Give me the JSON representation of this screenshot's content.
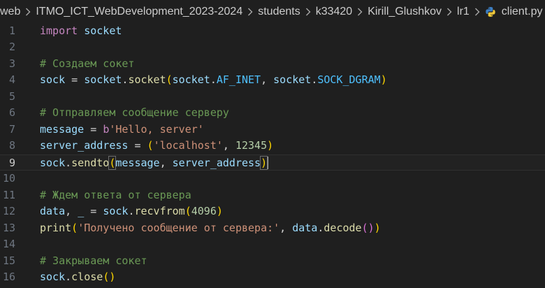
{
  "breadcrumb": {
    "items": [
      "web",
      "ITMO_ICT_WebDevelopment_2023-2024",
      "students",
      "k33420",
      "Kirill_Glushkov",
      "lr1"
    ],
    "file": "client.py",
    "more": "..."
  },
  "editor": {
    "language": "python",
    "current_line": 9,
    "lines": [
      {
        "n": "1",
        "tokens": [
          [
            "kw",
            "import"
          ],
          [
            "op",
            " "
          ],
          [
            "id",
            "socket"
          ]
        ]
      },
      {
        "n": "2",
        "tokens": []
      },
      {
        "n": "3",
        "tokens": [
          [
            "comment",
            "# Создаем сокет"
          ]
        ]
      },
      {
        "n": "4",
        "tokens": [
          [
            "id",
            "sock"
          ],
          [
            "op",
            " = "
          ],
          [
            "id",
            "socket"
          ],
          [
            "op",
            "."
          ],
          [
            "fn",
            "socket"
          ],
          [
            "p1",
            "("
          ],
          [
            "id",
            "socket"
          ],
          [
            "op",
            "."
          ],
          [
            "const",
            "AF_INET"
          ],
          [
            "op",
            ", "
          ],
          [
            "id",
            "socket"
          ],
          [
            "op",
            "."
          ],
          [
            "const",
            "SOCK_DGRAM"
          ],
          [
            "p1",
            ")"
          ]
        ]
      },
      {
        "n": "5",
        "tokens": []
      },
      {
        "n": "6",
        "tokens": [
          [
            "comment",
            "# Отправляем сообщение серверу"
          ]
        ]
      },
      {
        "n": "7",
        "tokens": [
          [
            "id",
            "message"
          ],
          [
            "op",
            " = "
          ],
          [
            "kw",
            "b"
          ],
          [
            "str",
            "'Hello, server'"
          ]
        ]
      },
      {
        "n": "8",
        "tokens": [
          [
            "id",
            "server_address"
          ],
          [
            "op",
            " = "
          ],
          [
            "p1",
            "("
          ],
          [
            "str",
            "'localhost'"
          ],
          [
            "op",
            ", "
          ],
          [
            "num",
            "12345"
          ],
          [
            "p1",
            ")"
          ]
        ]
      },
      {
        "n": "9",
        "tokens": [
          [
            "id",
            "sock"
          ],
          [
            "op",
            "."
          ],
          [
            "fn",
            "sendto"
          ],
          [
            "p1bm",
            "("
          ],
          [
            "id",
            "message"
          ],
          [
            "op",
            ", "
          ],
          [
            "id",
            "server_address"
          ],
          [
            "p1bm",
            ")"
          ],
          [
            "cursor",
            ""
          ]
        ]
      },
      {
        "n": "10",
        "tokens": []
      },
      {
        "n": "11",
        "tokens": [
          [
            "comment",
            "# Ждем ответа от сервера"
          ]
        ]
      },
      {
        "n": "12",
        "tokens": [
          [
            "id",
            "data"
          ],
          [
            "op",
            ", "
          ],
          [
            "id",
            "_"
          ],
          [
            "op",
            " = "
          ],
          [
            "id",
            "sock"
          ],
          [
            "op",
            "."
          ],
          [
            "fn",
            "recvfrom"
          ],
          [
            "p1",
            "("
          ],
          [
            "num",
            "4096"
          ],
          [
            "p1",
            ")"
          ]
        ]
      },
      {
        "n": "13",
        "tokens": [
          [
            "fn",
            "print"
          ],
          [
            "p1",
            "("
          ],
          [
            "str",
            "'Получено сообщение от сервера:'"
          ],
          [
            "op",
            ", "
          ],
          [
            "id",
            "data"
          ],
          [
            "op",
            "."
          ],
          [
            "fn",
            "decode"
          ],
          [
            "p2",
            "()"
          ],
          [
            "p1",
            ")"
          ]
        ]
      },
      {
        "n": "14",
        "tokens": []
      },
      {
        "n": "15",
        "tokens": [
          [
            "comment",
            "# Закрываем сокет"
          ]
        ]
      },
      {
        "n": "16",
        "tokens": [
          [
            "id",
            "sock"
          ],
          [
            "op",
            "."
          ],
          [
            "fn",
            "close"
          ],
          [
            "p1",
            "()"
          ]
        ]
      }
    ]
  },
  "colors": {
    "background": "#1f1f1f",
    "keyword": "#c586c0",
    "identifier": "#9cdcfe",
    "function": "#dcdcaa",
    "constant": "#4fc1ff",
    "string": "#ce9178",
    "number": "#b5cea8",
    "comment": "#6a9955",
    "bracket_level1": "#ffd700",
    "bracket_level2": "#da70d6"
  },
  "icons": {
    "separator": "chevron-right-icon",
    "file": "python-file-icon"
  }
}
